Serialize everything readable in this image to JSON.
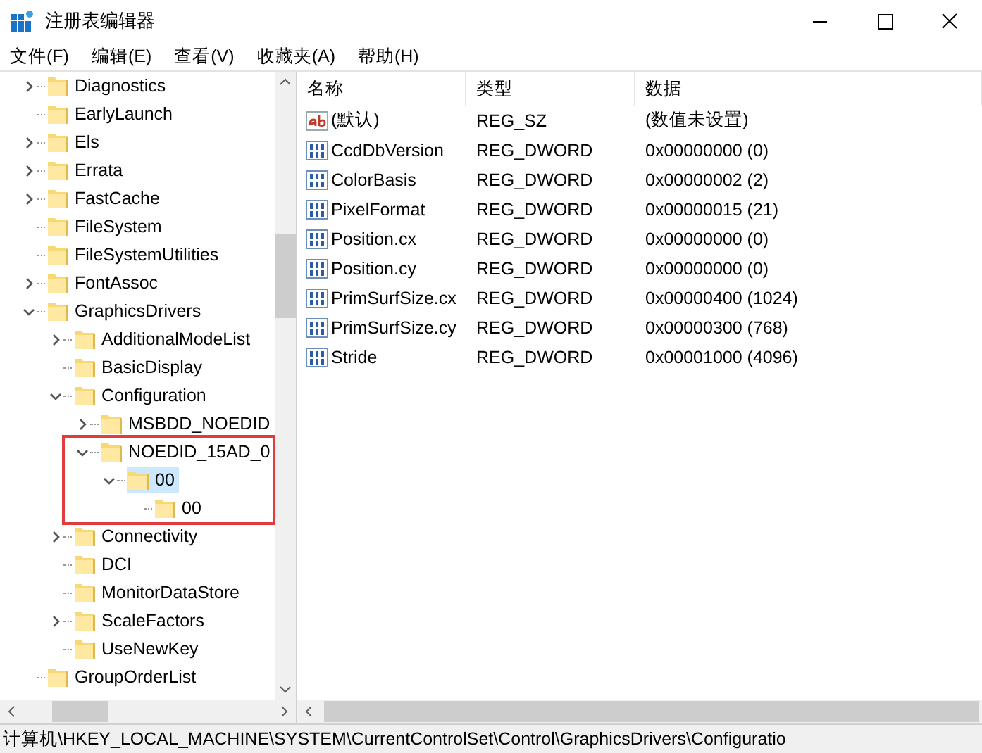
{
  "window": {
    "title": "注册表编辑器"
  },
  "menu": [
    "文件(F)",
    "编辑(E)",
    "查看(V)",
    "收藏夹(A)",
    "帮助(H)"
  ],
  "tree": [
    {
      "label": "Diagnostics",
      "expandable": true,
      "expanded": false
    },
    {
      "label": "EarlyLaunch",
      "expandable": false
    },
    {
      "label": "Els",
      "expandable": true,
      "expanded": false
    },
    {
      "label": "Errata",
      "expandable": true,
      "expanded": false
    },
    {
      "label": "FastCache",
      "expandable": true,
      "expanded": false
    },
    {
      "label": "FileSystem",
      "expandable": false
    },
    {
      "label": "FileSystemUtilities",
      "expandable": false
    },
    {
      "label": "FontAssoc",
      "expandable": true,
      "expanded": false
    },
    {
      "label": "GraphicsDrivers",
      "expandable": true,
      "expanded": true,
      "children": [
        {
          "label": "AdditionalModeList",
          "expandable": true,
          "expanded": false
        },
        {
          "label": "BasicDisplay",
          "expandable": false
        },
        {
          "label": "Configuration",
          "expandable": true,
          "expanded": true,
          "children": [
            {
              "label": "MSBDD_NOEDID",
              "expandable": true,
              "expanded": false
            },
            {
              "label": "NOEDID_15AD_0",
              "expandable": true,
              "expanded": true,
              "highlighted": true,
              "children": [
                {
                  "label": "00",
                  "expandable": true,
                  "expanded": true,
                  "selected": true,
                  "children": [
                    {
                      "label": "00",
                      "expandable": false
                    }
                  ]
                }
              ]
            }
          ]
        },
        {
          "label": "Connectivity",
          "expandable": true,
          "expanded": false
        },
        {
          "label": "DCI",
          "expandable": false
        },
        {
          "label": "MonitorDataStore",
          "expandable": false
        },
        {
          "label": "ScaleFactors",
          "expandable": true,
          "expanded": false
        },
        {
          "label": "UseNewKey",
          "expandable": false
        }
      ]
    },
    {
      "label": "GroupOrderList",
      "expandable": false
    }
  ],
  "table": {
    "columns": [
      "名称",
      "类型",
      "数据"
    ],
    "rows": [
      {
        "kind": "string",
        "name": "(默认)",
        "type": "REG_SZ",
        "data": "(数值未设置)"
      },
      {
        "kind": "binary",
        "name": "CcdDbVersion",
        "type": "REG_DWORD",
        "data": "0x00000000 (0)"
      },
      {
        "kind": "binary",
        "name": "ColorBasis",
        "type": "REG_DWORD",
        "data": "0x00000002 (2)"
      },
      {
        "kind": "binary",
        "name": "PixelFormat",
        "type": "REG_DWORD",
        "data": "0x00000015 (21)"
      },
      {
        "kind": "binary",
        "name": "Position.cx",
        "type": "REG_DWORD",
        "data": "0x00000000 (0)"
      },
      {
        "kind": "binary",
        "name": "Position.cy",
        "type": "REG_DWORD",
        "data": "0x00000000 (0)"
      },
      {
        "kind": "binary",
        "name": "PrimSurfSize.cx",
        "type": "REG_DWORD",
        "data": "0x00000400 (1024)"
      },
      {
        "kind": "binary",
        "name": "PrimSurfSize.cy",
        "type": "REG_DWORD",
        "data": "0x00000300 (768)"
      },
      {
        "kind": "binary",
        "name": "Stride",
        "type": "REG_DWORD",
        "data": "0x00001000 (4096)"
      }
    ]
  },
  "status_bar": "计算机\\HKEY_LOCAL_MACHINE\\SYSTEM\\CurrentControlSet\\Control\\GraphicsDrivers\\Configuratio"
}
